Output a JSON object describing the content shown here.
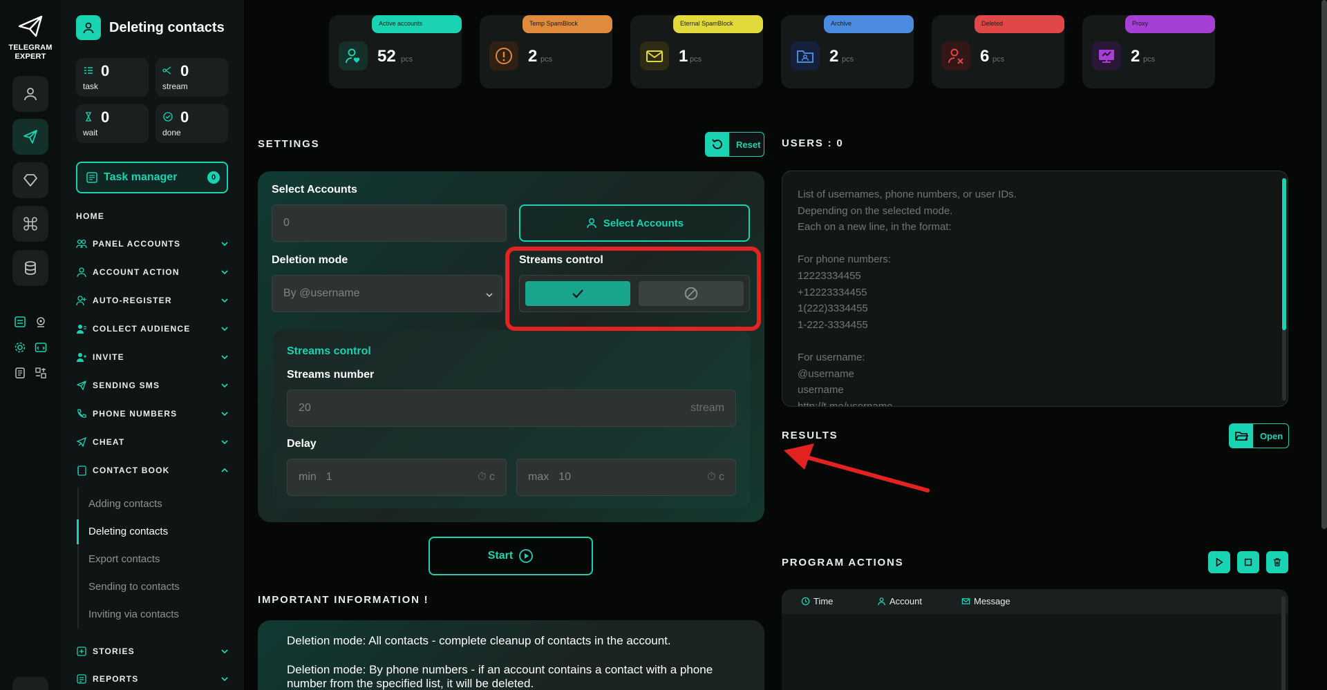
{
  "app": {
    "logo_text_1": "TELEGRAM",
    "logo_text_2": "EXPERT"
  },
  "sidebar": {
    "title": "Deleting contacts",
    "stats": [
      {
        "value": "0",
        "label": "task"
      },
      {
        "value": "0",
        "label": "stream"
      },
      {
        "value": "0",
        "label": "wait"
      },
      {
        "value": "0",
        "label": "done"
      }
    ],
    "task_manager": {
      "label": "Task manager",
      "count": "0"
    },
    "home": "HOME",
    "nav": [
      {
        "label": "PANEL ACCOUNTS"
      },
      {
        "label": "ACCOUNT ACTION"
      },
      {
        "label": "AUTO-REGISTER"
      },
      {
        "label": "COLLECT AUDIENCE"
      },
      {
        "label": "INVITE"
      },
      {
        "label": "SENDING SMS"
      },
      {
        "label": "PHONE NUMBERS"
      },
      {
        "label": "CHEAT"
      },
      {
        "label": "CONTACT BOOK"
      },
      {
        "label": "STORIES"
      },
      {
        "label": "REPORTS"
      }
    ],
    "contact_book_items": [
      {
        "label": "Adding contacts"
      },
      {
        "label": "Deleting contacts"
      },
      {
        "label": "Export contacts"
      },
      {
        "label": "Sending to contacts"
      },
      {
        "label": "Inviting via contacts"
      }
    ]
  },
  "cards": [
    {
      "pill": "Active accounts",
      "value": "52",
      "unit": "pcs",
      "color": "#19d3b3"
    },
    {
      "pill": "Temp SpamBlock",
      "value": "2",
      "unit": "pcs",
      "color": "#e08a3c"
    },
    {
      "pill": "Eternal SpamBlock",
      "value": "1",
      "unit": "pcs",
      "color": "#e2d93b"
    },
    {
      "pill": "Archive",
      "value": "2",
      "unit": "pcs",
      "color": "#4a8be0"
    },
    {
      "pill": "Deleted",
      "value": "6",
      "unit": "pcs",
      "color": "#e04848"
    },
    {
      "pill": "Proxy",
      "value": "2",
      "unit": "pcs",
      "color": "#a63fd6"
    }
  ],
  "settings": {
    "heading": "SETTINGS",
    "reset_label": "Reset",
    "select_accounts_label": "Select Accounts",
    "accounts_value": "0",
    "select_accounts_button": "Select Accounts",
    "deletion_mode_label": "Deletion mode",
    "deletion_mode_value": "By @username",
    "streams_control_label": "Streams control",
    "streams_control_on": true,
    "inner_title": "Streams control",
    "streams_number_label": "Streams number",
    "streams_number_placeholder": "20",
    "streams_suffix": "stream",
    "delay_label": "Delay",
    "delay_min_prefix": "min",
    "delay_min_placeholder": "1",
    "delay_max_prefix": "max",
    "delay_max_placeholder": "10",
    "delay_unit": "c",
    "start_label": "Start"
  },
  "info": {
    "heading": "IMPORTANT INFORMATION !",
    "paragraphs": [
      "Deletion mode: All contacts - complete cleanup of contacts in the account.",
      "Deletion mode: By phone numbers - if an account contains a contact with a phone number from the specified list, it will be deleted."
    ]
  },
  "users": {
    "heading": "USERS : 0",
    "placeholder_lines": [
      "List of usernames, phone numbers, or user IDs.",
      "Depending on the selected mode.",
      "Each on a new line, in the format:",
      "",
      "For phone numbers:",
      "12223334455",
      "+12223334455",
      "1(222)3334455",
      "1-222-3334455",
      "",
      "For username:",
      "@username",
      "username",
      "http://t.me/username"
    ]
  },
  "results": {
    "heading": "RESULTS",
    "open_label": "Open"
  },
  "program_actions": {
    "heading": "PROGRAM ACTIONS",
    "columns": [
      "Time",
      "Account",
      "Message"
    ]
  },
  "colors": {
    "accent": "#19d3b3",
    "highlight": "#e32222"
  }
}
